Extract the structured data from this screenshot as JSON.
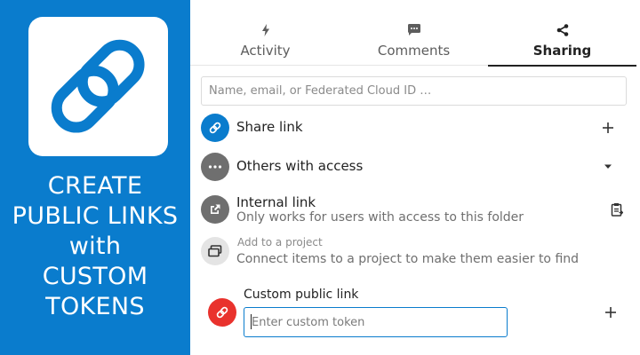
{
  "promo": {
    "lines": [
      "CREATE",
      "PUBLIC LINKS",
      "with",
      "CUSTOM",
      "TOKENS"
    ],
    "logo_icon": "chain-link-icon",
    "background_color": "#0a7ccd"
  },
  "tabs": [
    {
      "label": "Activity",
      "icon": "lightning-icon",
      "active": false
    },
    {
      "label": "Comments",
      "icon": "comment-icon",
      "active": false
    },
    {
      "label": "Sharing",
      "icon": "share-icon",
      "active": true
    }
  ],
  "search": {
    "placeholder": "Name, email, or Federated Cloud ID …",
    "value": ""
  },
  "shares": {
    "share_link": {
      "label": "Share link",
      "icon": "link-icon",
      "action_icon": "plus-icon"
    },
    "others_with_access": {
      "label": "Others with access",
      "icon": "more-horizontal-icon",
      "action_icon": "triangle-down-icon"
    },
    "internal_link": {
      "label": "Internal link",
      "subtitle": "Only works for users with access to this folder",
      "icon": "external-link-icon",
      "action_icon": "clipboard-icon"
    },
    "project": {
      "label": "Add to a project",
      "subtitle": "Connect items to a project to make them easier to find",
      "icon": "projects-icon"
    },
    "custom_link": {
      "label": "Custom public link",
      "placeholder": "Enter custom token",
      "value": "",
      "icon": "link-icon",
      "action_icon": "plus-icon"
    }
  },
  "colors": {
    "accent": "#0a7ccd",
    "danger": "#e9322d",
    "muted": "#6f6f6f"
  }
}
